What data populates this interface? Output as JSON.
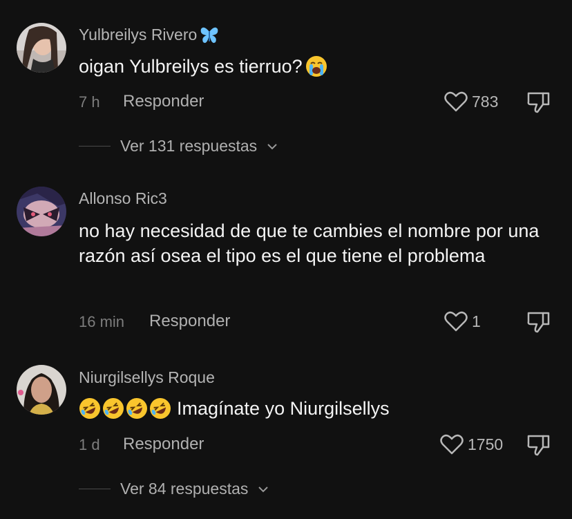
{
  "colors": {
    "background": "#111111",
    "username": "#b5b5b5",
    "text": "#f4f4f4",
    "muted": "#7d7d7d",
    "emoji_yellow": "#f9c52d",
    "butterfly_blue": "#6ec3ff"
  },
  "comments": [
    {
      "username": "Yulbreilys Rivero",
      "username_suffix_icon": "butterfly-emoji",
      "text": "oigan Yulbreilys es tierruo?",
      "text_suffix_icon": "loudly-crying-face-emoji",
      "time": "7 h",
      "reply_label": "Responder",
      "likes": "783",
      "view_replies": "Ver 131 respuestas"
    },
    {
      "username": "Allonso Ric3",
      "text": "no hay necesidad de que te cambies el nombre por una razón así osea el tipo es el que tiene el problema",
      "time": "16 min",
      "reply_label": "Responder",
      "likes": "1"
    },
    {
      "username": "Niurgilsellys Roque",
      "text_prefix_icons": [
        "rolling-on-floor-laughing-emoji",
        "rolling-on-floor-laughing-emoji",
        "rolling-on-floor-laughing-emoji",
        "rolling-on-floor-laughing-emoji"
      ],
      "text": "Imagínate yo Niurgilsellys",
      "time": "1 d",
      "reply_label": "Responder",
      "likes": "1750",
      "view_replies": "Ver 84 respuestas"
    }
  ]
}
